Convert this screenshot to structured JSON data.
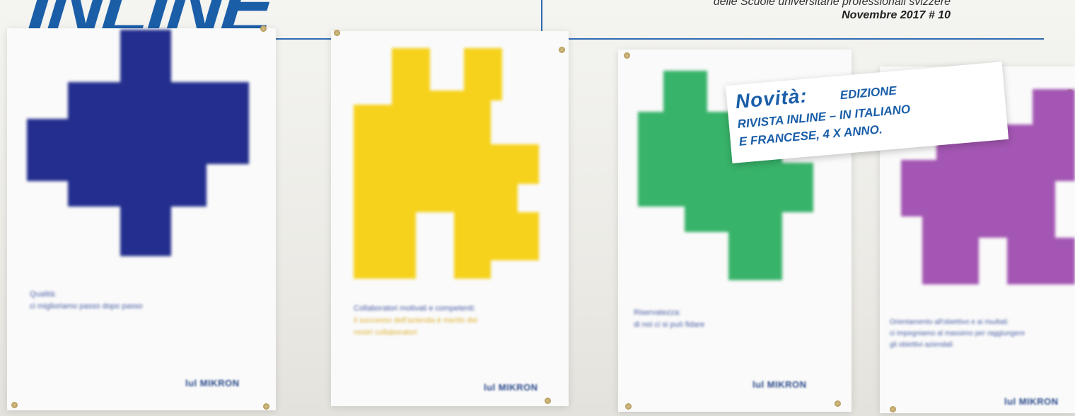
{
  "header": {
    "logo": "INLINE",
    "subtitle": "delle Scuole universitarie professionali svizzere",
    "issue": "Novembre 2017 # 10"
  },
  "promo": {
    "heading": "Novità:",
    "line1": "EDIZIONE",
    "line2": "RIVISTA INLINE – IN ITALIANO",
    "line3": "E FRANCESE, 4 X ANNO."
  },
  "posters": [
    {
      "color": "#232e8e",
      "caption": [
        "Qualità:",
        "ci miglioriamo passo dopo passo"
      ],
      "brand": "lul MIKRON"
    },
    {
      "color": "#f6d21c",
      "caption": [
        "Collaboratori motivati e competenti:",
        "il successo dell'azienda è merito dei",
        "nostri collaboratori"
      ],
      "brand": "lul MIKRON"
    },
    {
      "color": "#38b36a",
      "caption": [
        "Riservatezza:",
        "di noi ci si può fidare"
      ],
      "brand": "lul MIKRON"
    },
    {
      "color": "#a356b3",
      "caption": [
        "Orientamento all'obiettivo e ai risultati:",
        "ci impegniamo al massimo per raggiungere",
        "gli obiettivi aziendali"
      ],
      "brand": "lul MIKRON"
    }
  ]
}
